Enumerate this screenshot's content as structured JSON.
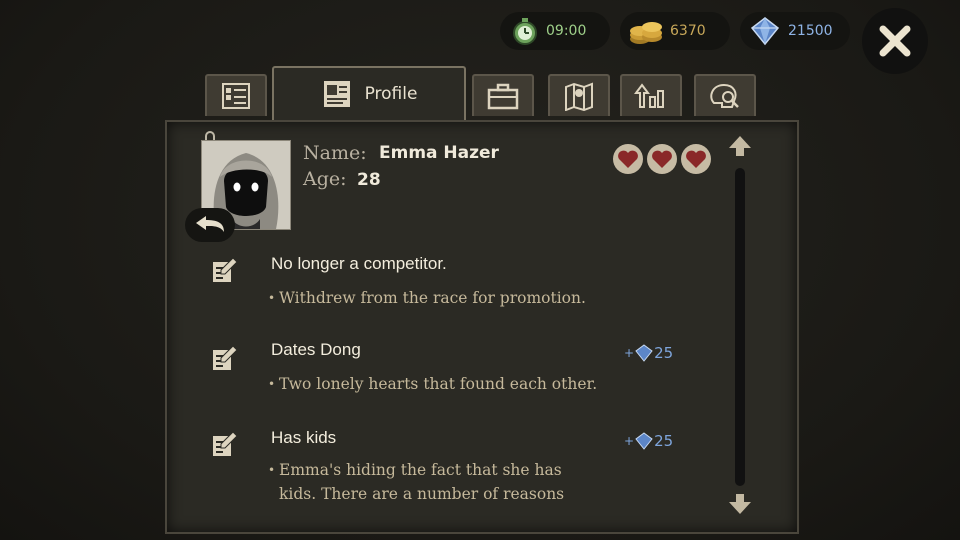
{
  "hud": {
    "timer": "09:00",
    "coins": "6370",
    "gems": "21500",
    "timer_icon": "stopwatch-icon",
    "coins_icon": "coin-stack-icon",
    "gems_icon": "diamond-icon"
  },
  "tabs": [
    {
      "icon": "checklist-icon",
      "label": ""
    },
    {
      "icon": "profile-card-icon",
      "label": "Profile"
    },
    {
      "icon": "briefcase-icon",
      "label": ""
    },
    {
      "icon": "map-icon",
      "label": ""
    },
    {
      "icon": "upgrade-icon",
      "label": ""
    },
    {
      "icon": "brain-search-icon",
      "label": ""
    }
  ],
  "profile": {
    "name_label": "Name:",
    "name": "Emma Hazer",
    "age_label": "Age:",
    "age": "28",
    "hearts": 3
  },
  "traits": [
    {
      "title": "No longer a competitor.",
      "desc": "Withdrew from the race for promotion.",
      "reward": ""
    },
    {
      "title": "Dates Dong",
      "desc": "Two lonely hearts that found each other.",
      "reward": "+25"
    },
    {
      "title": "Has kids",
      "desc": "Emma's hiding the fact that she has kids. There are a number of reasons",
      "reward": "+25"
    }
  ],
  "colors": {
    "panel": "#2b2a24",
    "heart": "#8a2828",
    "reward": "#7ea5dc"
  }
}
